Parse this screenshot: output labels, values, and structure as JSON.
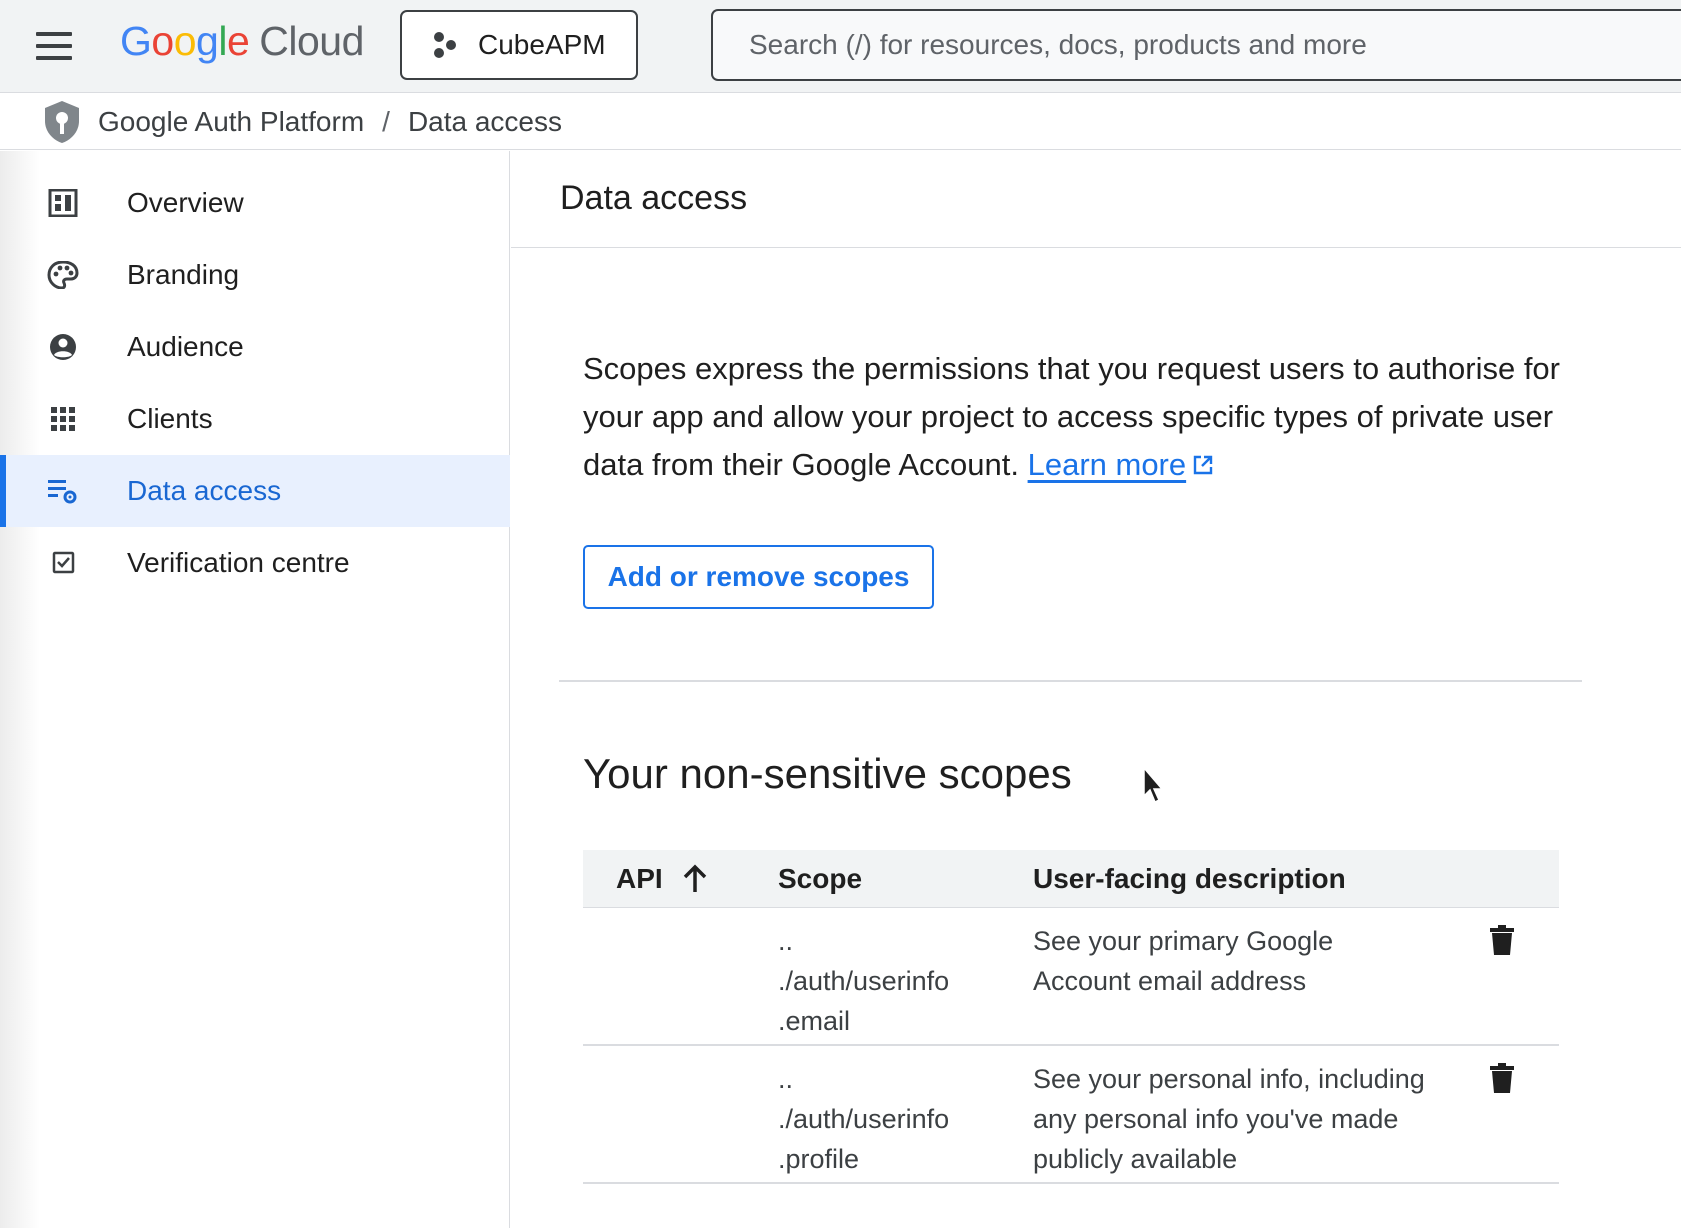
{
  "header": {
    "logo": {
      "google_letters": [
        "G",
        "o",
        "o",
        "g",
        "l",
        "e"
      ],
      "google_colors": [
        "#4285F4",
        "#EA4335",
        "#FBBC05",
        "#4285F4",
        "#34A853",
        "#EA4335"
      ],
      "cloud": "Cloud"
    },
    "project": {
      "label": "CubeAPM",
      "icon": "project-hexagon-icon"
    },
    "search": {
      "placeholder": "Search (/) for resources, docs, products and more",
      "value": ""
    },
    "menu_icon": "hamburger-menu-icon"
  },
  "breadcrumb": {
    "icon": "shield-key-icon",
    "items": [
      "Google Auth Platform",
      "Data access"
    ],
    "separator": "/"
  },
  "sidebar": {
    "items": [
      {
        "label": "Overview",
        "icon": "dashboard-icon",
        "active": false
      },
      {
        "label": "Branding",
        "icon": "palette-icon",
        "active": false
      },
      {
        "label": "Audience",
        "icon": "account-circle-icon",
        "active": false
      },
      {
        "label": "Clients",
        "icon": "apps-grid-icon",
        "active": false
      },
      {
        "label": "Data access",
        "icon": "list-settings-icon",
        "active": true
      },
      {
        "label": "Verification centre",
        "icon": "checkbox-icon",
        "active": false
      }
    ]
  },
  "main": {
    "title": "Data access",
    "description": "Scopes express the permissions that you request users to authorise for your app and allow your project to access specific types of private user data from their Google Account.",
    "learn_more": "Learn more",
    "add_scopes_button": "Add or remove scopes",
    "section_title": "Your non-sensitive scopes",
    "table": {
      "columns": [
        "API",
        "Scope",
        "User-facing description"
      ],
      "sort": {
        "column": "API",
        "direction": "ascending"
      },
      "rows": [
        {
          "api": "",
          "scope_lines": [
            "..",
            "./auth/userinfo",
            ".email"
          ],
          "description": "See your primary Google Account email address"
        },
        {
          "api": "",
          "scope_lines": [
            "..",
            "./auth/userinfo",
            ".profile"
          ],
          "description": "See your personal info, including any personal info you've made publicly available"
        }
      ]
    }
  },
  "colors": {
    "accent": "#1a73e8",
    "active_bg": "#e8f0fe",
    "header_bg": "#f1f3f4"
  }
}
